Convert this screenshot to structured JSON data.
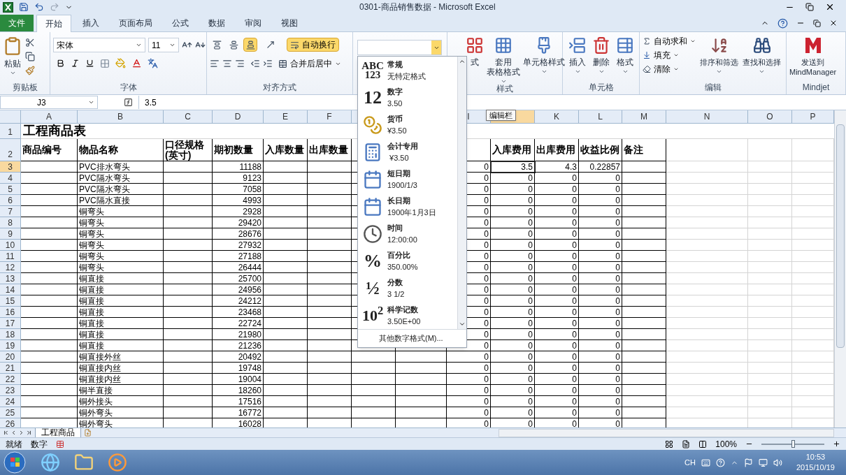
{
  "title_bar": {
    "title": "0301-商品销售数据 - Microsoft Excel"
  },
  "ribbon_tabs": [
    {
      "label": "文件",
      "kind": "file",
      "selected": false
    },
    {
      "label": "开始",
      "kind": "tab",
      "selected": true
    },
    {
      "label": "插入",
      "kind": "tab",
      "selected": false
    },
    {
      "label": "页面布局",
      "kind": "tab",
      "selected": false
    },
    {
      "label": "公式",
      "kind": "tab",
      "selected": false
    },
    {
      "label": "数据",
      "kind": "tab",
      "selected": false
    },
    {
      "label": "审阅",
      "kind": "tab",
      "selected": false
    },
    {
      "label": "视图",
      "kind": "tab",
      "selected": false
    }
  ],
  "ribbon": {
    "clipboard": {
      "label": "剪贴板",
      "paste": "粘贴"
    },
    "font": {
      "label": "字体",
      "font_name": "宋体",
      "font_size": "11"
    },
    "alignment": {
      "label": "对齐方式",
      "vertical_align": [
        {
          "selected": false
        },
        {
          "selected": false
        },
        {
          "selected": true
        }
      ],
      "wrap_text": {
        "label": "自动换行",
        "on": true
      },
      "merge": "合并后居中"
    },
    "number": {
      "menu_open": true
    },
    "styles": {
      "label": "样式",
      "buttons": [
        {
          "lines": [
            "式"
          ]
        },
        {
          "lines": [
            "套用",
            "表格格式"
          ]
        },
        {
          "lines": [
            "单元格样式"
          ]
        }
      ]
    },
    "cells": {
      "label": "单元格",
      "buttons": [
        "插入",
        "删除",
        "格式"
      ]
    },
    "editing": {
      "label": "编辑",
      "small": [
        "自动求和",
        "填充",
        "清除"
      ],
      "buttons": [
        "排序和筛选",
        "查找和选择"
      ]
    },
    "mindjet": {
      "label": "Mindjet",
      "lines": [
        "发送到",
        "MindManager"
      ]
    }
  },
  "formula_bar": {
    "name_box": "J3",
    "value": "3.5"
  },
  "tooltip": "编辑栏",
  "number_format_menu": {
    "items": [
      {
        "kind": "general",
        "glyph": "ABC\n123",
        "name": "常规",
        "sample": "无特定格式"
      },
      {
        "kind": "number",
        "glyph": "12",
        "name": "数字",
        "sample": "3.50"
      },
      {
        "kind": "currency",
        "name": "货币",
        "sample": "¥3.50"
      },
      {
        "kind": "accounting",
        "name": "会计专用",
        "sample": " ¥3.50"
      },
      {
        "kind": "short_date",
        "name": "短日期",
        "sample": "1900/1/3"
      },
      {
        "kind": "long_date",
        "name": "长日期",
        "sample": "1900年1月3日"
      },
      {
        "kind": "time",
        "name": "时间",
        "sample": "12:00:00"
      },
      {
        "kind": "percent",
        "glyph": "%",
        "name": "百分比",
        "sample": "350.00%"
      },
      {
        "kind": "fraction",
        "glyph": "½",
        "name": "分数",
        "sample": "3 1/2"
      },
      {
        "kind": "scientific",
        "glyph": "10$^{2}$",
        "name": "科学记数",
        "sample": "3.50E+00"
      }
    ],
    "footer": "其他数字格式(M)..."
  },
  "sheet": {
    "columns": [
      {
        "label": "A",
        "selected": false
      },
      {
        "label": "B",
        "selected": false
      },
      {
        "label": "C",
        "selected": false
      },
      {
        "label": "D",
        "selected": false
      },
      {
        "label": "E",
        "selected": false
      },
      {
        "label": "F",
        "selected": false
      },
      {
        "selected": false
      },
      {},
      {
        "label": "I",
        "selected": false
      },
      {
        "selected": true
      },
      {
        "label": "K",
        "selected": false
      },
      {
        "label": "L",
        "selected": false
      },
      {
        "label": "M",
        "selected": false
      },
      {
        "label": "N",
        "selected": false
      },
      {
        "label": "O",
        "selected": false
      },
      {
        "label": "P",
        "selected": false
      }
    ],
    "title_row_number": "1",
    "title": "工程商品表",
    "header_row_number": "2",
    "headers": {
      "code": "商品编号",
      "name": "物品名称",
      "size": "口径规格(英寸)",
      "opening_qty": "期初数量",
      "in_qty": "入库数量",
      "out_qty": "出库数量",
      "in_cost": "入库费用",
      "out_cost": "出库费用",
      "ratio": "收益比例",
      "note": "备注"
    },
    "rows": [
      {
        "row": "3",
        "selected": true,
        "name": "PVC排水弯头",
        "opening_qty": "11188",
        "column_9": "0",
        "in_cost": "3.5",
        "out_cost": "4.3",
        "ratio": "0.22857"
      },
      {
        "row": "4",
        "selected": false,
        "name": "PVC隔水弯头",
        "opening_qty": "9123",
        "column_9": "0",
        "in_cost": "0",
        "out_cost": "0",
        "ratio": "0"
      },
      {
        "row": "5",
        "selected": false,
        "name": "PVC隔水弯头",
        "opening_qty": "7058",
        "column_9": "0",
        "in_cost": "0",
        "out_cost": "0",
        "ratio": "0"
      },
      {
        "row": "6",
        "selected": false,
        "name": "PVC隔水直接",
        "opening_qty": "4993",
        "column_9": "0",
        "in_cost": "0",
        "out_cost": "0",
        "ratio": "0"
      },
      {
        "row": "7",
        "selected": false,
        "name": "铜弯头",
        "opening_qty": "2928",
        "column_9": "0",
        "in_cost": "0",
        "out_cost": "0",
        "ratio": "0"
      },
      {
        "row": "8",
        "selected": false,
        "name": "铜弯头",
        "opening_qty": "29420",
        "column_9": "0",
        "in_cost": "0",
        "out_cost": "0",
        "ratio": "0"
      },
      {
        "row": "9",
        "selected": false,
        "name": "铜弯头",
        "opening_qty": "28676",
        "column_9": "0",
        "in_cost": "0",
        "out_cost": "0",
        "ratio": "0"
      },
      {
        "row": "10",
        "selected": false,
        "name": "铜弯头",
        "opening_qty": "27932",
        "column_9": "0",
        "in_cost": "0",
        "out_cost": "0",
        "ratio": "0"
      },
      {
        "row": "11",
        "selected": false,
        "name": "铜弯头",
        "opening_qty": "27188",
        "column_9": "0",
        "in_cost": "0",
        "out_cost": "0",
        "ratio": "0"
      },
      {
        "row": "12",
        "selected": false,
        "name": "铜弯头",
        "opening_qty": "26444",
        "column_9": "0",
        "in_cost": "0",
        "out_cost": "0",
        "ratio": "0"
      },
      {
        "row": "13",
        "selected": false,
        "name": "铜直接",
        "opening_qty": "25700",
        "column_9": "0",
        "in_cost": "0",
        "out_cost": "0",
        "ratio": "0"
      },
      {
        "row": "14",
        "selected": false,
        "name": "铜直接",
        "opening_qty": "24956",
        "column_9": "0",
        "in_cost": "0",
        "out_cost": "0",
        "ratio": "0"
      },
      {
        "row": "15",
        "selected": false,
        "name": "铜直接",
        "opening_qty": "24212",
        "column_9": "0",
        "in_cost": "0",
        "out_cost": "0",
        "ratio": "0"
      },
      {
        "row": "16",
        "selected": false,
        "name": "铜直接",
        "opening_qty": "23468",
        "column_9": "0",
        "in_cost": "0",
        "out_cost": "0",
        "ratio": "0"
      },
      {
        "row": "17",
        "selected": false,
        "name": "铜直接",
        "opening_qty": "22724",
        "column_9": "0",
        "in_cost": "0",
        "out_cost": "0",
        "ratio": "0"
      },
      {
        "row": "18",
        "selected": false,
        "name": "铜直接",
        "opening_qty": "21980",
        "column_9": "0",
        "in_cost": "0",
        "out_cost": "0",
        "ratio": "0"
      },
      {
        "row": "19",
        "selected": false,
        "name": "铜直接",
        "opening_qty": "21236",
        "column_9": "0",
        "in_cost": "0",
        "out_cost": "0",
        "ratio": "0"
      },
      {
        "row": "20",
        "selected": false,
        "name": "铜直接外丝",
        "opening_qty": "20492",
        "column_9": "0",
        "in_cost": "0",
        "out_cost": "0",
        "ratio": "0"
      },
      {
        "row": "21",
        "selected": false,
        "name": "铜直接内丝",
        "opening_qty": "19748",
        "column_9": "0",
        "in_cost": "0",
        "out_cost": "0",
        "ratio": "0"
      },
      {
        "row": "22",
        "selected": false,
        "name": "铜直接内丝",
        "opening_qty": "19004",
        "column_9": "0",
        "in_cost": "0",
        "out_cost": "0",
        "ratio": "0"
      },
      {
        "row": "23",
        "selected": false,
        "name": "铜半直接",
        "opening_qty": "18260",
        "column_9": "0",
        "in_cost": "0",
        "out_cost": "0",
        "ratio": "0"
      },
      {
        "row": "24",
        "selected": false,
        "name": "铜外接头",
        "opening_qty": "17516",
        "column_9": "0",
        "in_cost": "0",
        "out_cost": "0",
        "ratio": "0"
      },
      {
        "row": "25",
        "selected": false,
        "name": "铜外弯头",
        "opening_qty": "16772",
        "column_9": "0",
        "in_cost": "0",
        "out_cost": "0",
        "ratio": "0"
      },
      {
        "row": "26",
        "selected": false,
        "name": "铜外弯头",
        "opening_qty": "16028",
        "column_9": "0",
        "in_cost": "0",
        "out_cost": "0",
        "ratio": "0"
      }
    ]
  },
  "sheet_tabs": [
    {
      "label": "工程商品",
      "selected": true
    }
  ],
  "status_bar": {
    "mode": "就绪",
    "indicator": "数字",
    "zoom": "100%",
    "zoom_slider": {
      "level": 0.5
    }
  },
  "taskbar": {
    "language": "CH",
    "time": "10:53",
    "date": "2015/10/19"
  }
}
